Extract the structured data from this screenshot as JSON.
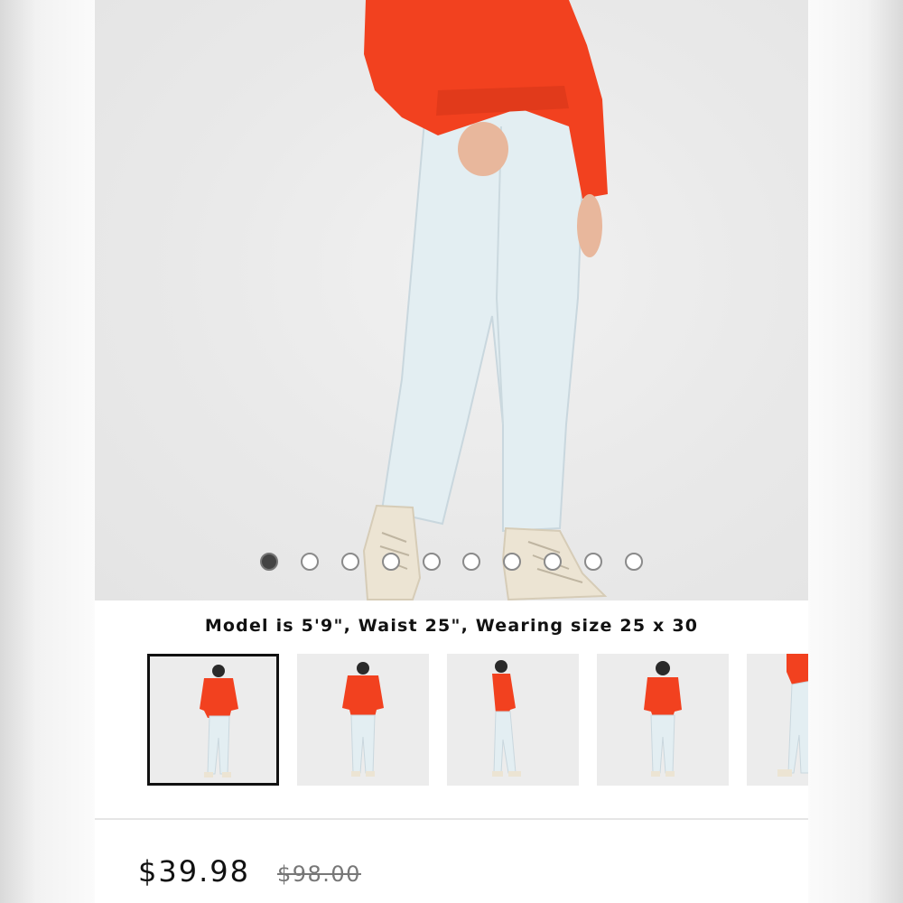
{
  "gallery": {
    "slide_count": 10,
    "active_slide": 1
  },
  "product": {
    "model_info": "Model is 5'9\", Waist 25\", Wearing size 25 x 30",
    "price_current": "$39.98",
    "price_original": "$98.00"
  },
  "thumbnails": [
    {
      "view": "front-three-quarter",
      "selected": true
    },
    {
      "view": "front",
      "selected": false
    },
    {
      "view": "side",
      "selected": false
    },
    {
      "view": "back",
      "selected": false
    },
    {
      "view": "detail",
      "selected": false
    }
  ],
  "colors": {
    "sweatshirt": "#f2411f",
    "jeans": "#e3eef2",
    "sneakers": "#ece4d3",
    "background": "#ebebeb"
  }
}
